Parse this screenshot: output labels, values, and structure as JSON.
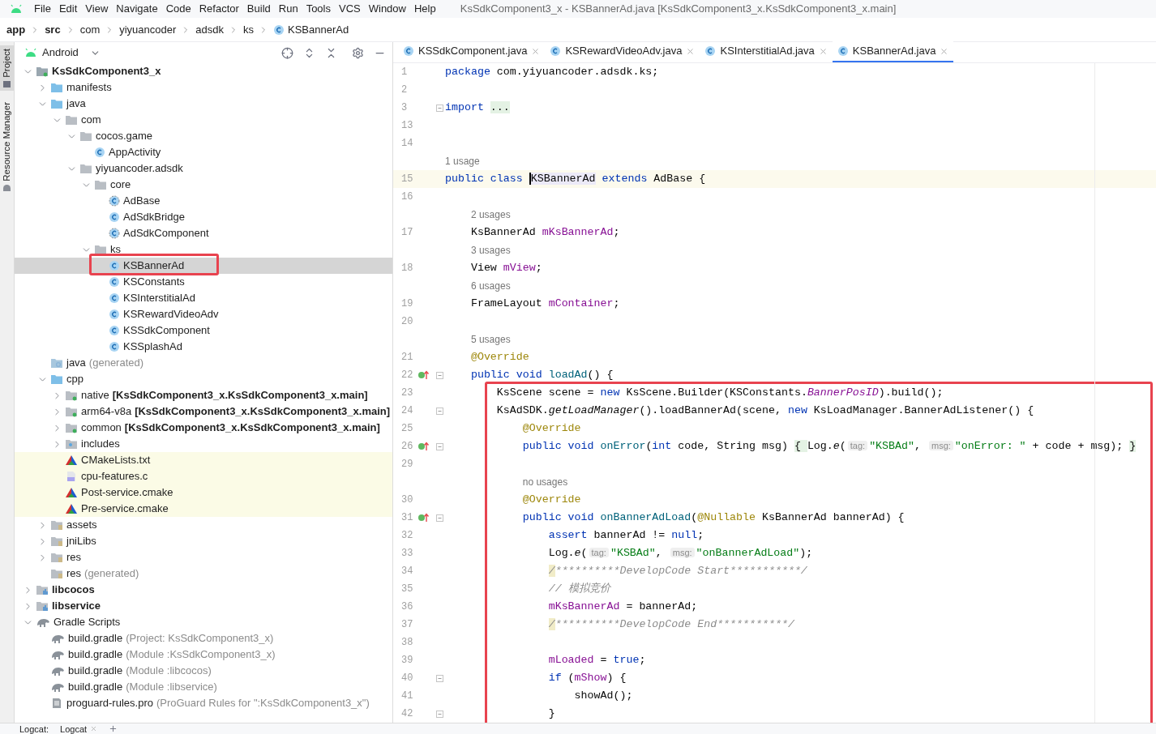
{
  "menu": [
    "File",
    "Edit",
    "View",
    "Navigate",
    "Code",
    "Refactor",
    "Build",
    "Run",
    "Tools",
    "VCS",
    "Window",
    "Help"
  ],
  "window": {
    "title": "KsSdkComponent3_x - KSBannerAd.java [KsSdkComponent3_x.KsSdkComponent3_x.main]"
  },
  "breadcrumb": [
    {
      "label": "app",
      "kind": "module"
    },
    {
      "label": "src",
      "kind": "module"
    },
    {
      "label": "com",
      "kind": "plain"
    },
    {
      "label": "yiyuancoder",
      "kind": "plain"
    },
    {
      "label": "adsdk",
      "kind": "plain"
    },
    {
      "label": "ks",
      "kind": "plain"
    },
    {
      "label": "KSBannerAd",
      "kind": "class"
    }
  ],
  "side_strip": [
    "Project",
    "Resource Manager"
  ],
  "project_panel": {
    "view": "Android",
    "tree": [
      {
        "label": "KsSdkComponent3_x",
        "kind": "project",
        "expanded": true,
        "selected": false,
        "children": [
          {
            "label": "manifests",
            "kind": "folder",
            "expanded": false,
            "selected": false
          },
          {
            "label": "java",
            "kind": "folder",
            "expanded": true,
            "selected": false,
            "children": [
              {
                "label": "com",
                "kind": "package",
                "expanded": true,
                "selected": false,
                "children": [
                  {
                    "label": "cocos.game",
                    "kind": "package",
                    "expanded": true,
                    "selected": false,
                    "children": [
                      {
                        "label": "AppActivity",
                        "kind": "class",
                        "selected": false
                      }
                    ]
                  },
                  {
                    "label": "yiyuancoder.adsdk",
                    "kind": "package",
                    "expanded": true,
                    "selected": false,
                    "children": [
                      {
                        "label": "core",
                        "kind": "package",
                        "expanded": true,
                        "selected": false,
                        "children": [
                          {
                            "label": "AdBase",
                            "kind": "abstract",
                            "selected": false
                          },
                          {
                            "label": "AdSdkBridge",
                            "kind": "class",
                            "selected": false
                          },
                          {
                            "label": "AdSdkComponent",
                            "kind": "abstract",
                            "selected": false
                          }
                        ]
                      },
                      {
                        "label": "ks",
                        "kind": "package",
                        "expanded": true,
                        "selected": false,
                        "children": [
                          {
                            "label": "KSBannerAd",
                            "kind": "class",
                            "selected": true,
                            "framed": true
                          },
                          {
                            "label": "KSConstants",
                            "kind": "class",
                            "selected": false
                          },
                          {
                            "label": "KSInterstitialAd",
                            "kind": "class",
                            "selected": false
                          },
                          {
                            "label": "KSRewardVideoAdv",
                            "kind": "class",
                            "selected": false
                          },
                          {
                            "label": "KSSdkComponent",
                            "kind": "class",
                            "selected": false
                          },
                          {
                            "label": "KSSplashAd",
                            "kind": "class",
                            "selected": false
                          }
                        ]
                      }
                    ]
                  }
                ]
              }
            ]
          },
          {
            "label": "java",
            "note": "(generated)",
            "kind": "generated",
            "selected": false
          },
          {
            "label": "cpp",
            "kind": "folder",
            "expanded": true,
            "selected": false,
            "children": [
              {
                "label": "native",
                "context": "[KsSdkComponent3_x.KsSdkComponent3_x.main]",
                "kind": "native",
                "expanded": false,
                "selected": false,
                "highlighted": false
              },
              {
                "label": "arm64-v8a",
                "context": "[KsSdkComponent3_x.KsSdkComponent3_x.main]",
                "kind": "native",
                "expanded": false,
                "selected": false,
                "highlighted": false
              },
              {
                "label": "common",
                "context": "[KsSdkComponent3_x.KsSdkComponent3_x.main]",
                "kind": "native",
                "expanded": false,
                "selected": false,
                "highlighted": false
              },
              {
                "label": "includes",
                "kind": "include",
                "expanded": false,
                "selected": false,
                "highlighted": false
              },
              {
                "label": "CMakeLists.txt",
                "kind": "cmake",
                "selected": false,
                "highlighted": true
              },
              {
                "label": "cpu-features.c",
                "kind": "cfile",
                "selected": false,
                "highlighted": true
              },
              {
                "label": "Post-service.cmake",
                "kind": "cmake",
                "selected": false,
                "highlighted": true
              },
              {
                "label": "Pre-service.cmake",
                "kind": "cmake",
                "selected": false,
                "highlighted": true
              }
            ]
          },
          {
            "label": "assets",
            "kind": "resfolder",
            "expanded": false,
            "selected": false
          },
          {
            "label": "jniLibs",
            "kind": "resfolder",
            "expanded": false,
            "selected": false
          },
          {
            "label": "res",
            "kind": "resfolder",
            "expanded": false,
            "selected": false
          },
          {
            "label": "res",
            "note": "(generated)",
            "kind": "resfolder",
            "selected": false
          }
        ]
      },
      {
        "label": "libcocos",
        "kind": "module",
        "expanded": false,
        "selected": false
      },
      {
        "label": "libservice",
        "kind": "module",
        "expanded": false,
        "selected": false
      },
      {
        "label": "Gradle Scripts",
        "kind": "gradle",
        "expanded": true,
        "selected": false,
        "children": [
          {
            "label": "build.gradle",
            "note": "(Project: KsSdkComponent3_x)",
            "kind": "gradle",
            "selected": false
          },
          {
            "label": "build.gradle",
            "note": "(Module :KsSdkComponent3_x)",
            "kind": "gradle",
            "selected": false
          },
          {
            "label": "build.gradle",
            "note": "(Module :libcocos)",
            "kind": "gradle",
            "selected": false
          },
          {
            "label": "build.gradle",
            "note": "(Module :libservice)",
            "kind": "gradle",
            "selected": false
          },
          {
            "label": "proguard-rules.pro",
            "note": "(ProGuard Rules for \":KsSdkComponent3_x\")",
            "kind": "text",
            "selected": false
          }
        ]
      }
    ]
  },
  "tabs": [
    {
      "label": "KSSdkComponent.java",
      "selected": false
    },
    {
      "label": "KSRewardVideoAdv.java",
      "selected": false
    },
    {
      "label": "KSInterstitialAd.java",
      "selected": false
    },
    {
      "label": "KSBannerAd.java",
      "selected": true
    }
  ],
  "editor": {
    "lines": [
      {
        "kind": "code",
        "number": "1",
        "tokens": [
          {
            "kind": "kw",
            "text": "package"
          },
          {
            "kind": "plain",
            "text": " com.yiyuancoder.adsdk.ks;"
          }
        ]
      },
      {
        "kind": "code",
        "number": "2"
      },
      {
        "kind": "code",
        "number": "3",
        "gutter": [
          {
            "kind": "fold"
          }
        ],
        "tokens": [
          {
            "kind": "kw",
            "text": "import "
          },
          {
            "kind": "fold",
            "text": "..."
          }
        ]
      },
      {
        "kind": "code",
        "number": "13"
      },
      {
        "kind": "code",
        "number": "14"
      },
      {
        "kind": "usage",
        "text": "1 usage"
      },
      {
        "kind": "code",
        "number": "15",
        "current": true,
        "tokens": [
          {
            "kind": "kw",
            "text": "public class "
          },
          {
            "kind": "ident",
            "text": "KSBannerAd"
          },
          {
            "kind": "kw",
            "text": " extends"
          },
          {
            "kind": "plain",
            "text": " AdBase {"
          }
        ]
      },
      {
        "kind": "code",
        "number": "16"
      },
      {
        "kind": "usage",
        "text": "2 usages"
      },
      {
        "kind": "code",
        "number": "17",
        "tokens": [
          {
            "kind": "plain",
            "text": "    KsBannerAd "
          },
          {
            "kind": "field",
            "text": "mKsBannerAd"
          },
          {
            "kind": "plain",
            "text": ";"
          }
        ]
      },
      {
        "kind": "usage",
        "text": "3 usages"
      },
      {
        "kind": "code",
        "number": "18",
        "tokens": [
          {
            "kind": "plain",
            "text": "    View "
          },
          {
            "kind": "field",
            "text": "mView"
          },
          {
            "kind": "plain",
            "text": ";"
          }
        ]
      },
      {
        "kind": "usage",
        "text": "6 usages"
      },
      {
        "kind": "code",
        "number": "19",
        "tokens": [
          {
            "kind": "plain",
            "text": "    FrameLayout "
          },
          {
            "kind": "field",
            "text": "mContainer"
          },
          {
            "kind": "plain",
            "text": ";"
          }
        ]
      },
      {
        "kind": "code",
        "number": "20"
      },
      {
        "kind": "usage",
        "text": "5 usages"
      },
      {
        "kind": "code",
        "number": "21",
        "tokens": [
          {
            "kind": "ann",
            "text": "    @Override"
          }
        ]
      },
      {
        "kind": "code",
        "number": "22",
        "gutter": [
          {
            "kind": "override"
          },
          {
            "kind": "fold"
          }
        ],
        "tokens": [
          {
            "kind": "kw",
            "text": "    public void "
          },
          {
            "kind": "method",
            "text": "loadAd"
          },
          {
            "kind": "plain",
            "text": "() {"
          }
        ]
      }
    ],
    "framed_lines": [
      {
        "kind": "code",
        "number": "23",
        "tokens": [
          {
            "kind": "plain",
            "text": "        KsScene scene = "
          },
          {
            "kind": "kw",
            "text": "new"
          },
          {
            "kind": "plain",
            "text": " KsScene.Builder(KSConstants."
          },
          {
            "kind": "sfield",
            "text": "BannerPosID"
          },
          {
            "kind": "plain",
            "text": ").build();"
          }
        ]
      },
      {
        "kind": "code",
        "number": "24",
        "gutter": [
          {
            "kind": "fold"
          }
        ],
        "tokens": [
          {
            "kind": "plain",
            "text": "        KsAdSDK."
          },
          {
            "kind": "it",
            "text": "getLoadManager"
          },
          {
            "kind": "plain",
            "text": "().loadBannerAd(scene, "
          },
          {
            "kind": "kw",
            "text": "new"
          },
          {
            "kind": "plain",
            "text": " KsLoadManager.BannerAdListener() {"
          }
        ]
      },
      {
        "kind": "code",
        "number": "25",
        "tokens": [
          {
            "kind": "ann",
            "text": "            @Override"
          }
        ]
      },
      {
        "kind": "code",
        "number": "26",
        "gutter": [
          {
            "kind": "override"
          },
          {
            "kind": "fold"
          }
        ],
        "tokens": [
          {
            "kind": "kw",
            "text": "            public void "
          },
          {
            "kind": "method",
            "text": "onError"
          },
          {
            "kind": "plain",
            "text": "("
          },
          {
            "kind": "kw",
            "text": "int"
          },
          {
            "kind": "plain",
            "text": " code, String msg) "
          },
          {
            "kind": "fold",
            "text": "{ "
          },
          {
            "kind": "plain",
            "text": "Log."
          },
          {
            "kind": "it",
            "text": "e"
          },
          {
            "kind": "plain",
            "text": "("
          },
          {
            "kind": "hint",
            "text": "tag:"
          },
          {
            "kind": "str",
            "text": "\"KSBAd\""
          },
          {
            "kind": "plain",
            "text": ", "
          },
          {
            "kind": "hint",
            "text": "msg:"
          },
          {
            "kind": "str",
            "text": "\"onError: \""
          },
          {
            "kind": "plain",
            "text": " + code + msg); "
          },
          {
            "kind": "fold",
            "text": "}"
          }
        ]
      },
      {
        "kind": "code",
        "number": "29"
      },
      {
        "kind": "usage",
        "text": "no usages"
      },
      {
        "kind": "code",
        "number": "30",
        "tokens": [
          {
            "kind": "ann",
            "text": "            @Override"
          }
        ]
      },
      {
        "kind": "code",
        "number": "31",
        "gutter": [
          {
            "kind": "override"
          },
          {
            "kind": "fold"
          }
        ],
        "tokens": [
          {
            "kind": "kw",
            "text": "            public void "
          },
          {
            "kind": "method",
            "text": "onBannerAdLoad"
          },
          {
            "kind": "plain",
            "text": "("
          },
          {
            "kind": "ann",
            "text": "@Nullable"
          },
          {
            "kind": "plain",
            "text": " KsBannerAd bannerAd) {"
          }
        ]
      },
      {
        "kind": "code",
        "number": "32",
        "tokens": [
          {
            "kind": "kw",
            "text": "                assert"
          },
          {
            "kind": "plain",
            "text": " bannerAd != "
          },
          {
            "kind": "kw",
            "text": "null"
          },
          {
            "kind": "plain",
            "text": ";"
          }
        ]
      },
      {
        "kind": "code",
        "number": "33",
        "tokens": [
          {
            "kind": "plain",
            "text": "                Log."
          },
          {
            "kind": "it",
            "text": "e"
          },
          {
            "kind": "plain",
            "text": "("
          },
          {
            "kind": "hint",
            "text": "tag:"
          },
          {
            "kind": "str",
            "text": "\"KSBAd\""
          },
          {
            "kind": "plain",
            "text": ", "
          },
          {
            "kind": "hint",
            "text": "msg:"
          },
          {
            "kind": "str",
            "text": "\"onBannerAdLoad\""
          },
          {
            "kind": "plain",
            "text": ");"
          }
        ]
      },
      {
        "kind": "code",
        "number": "34",
        "tokens": [
          {
            "kind": "todo",
            "text": "                /"
          },
          {
            "kind": "cmt",
            "text": "**********DevelopCode Start***********/"
          }
        ]
      },
      {
        "kind": "code",
        "number": "35",
        "tokens": [
          {
            "kind": "cmt",
            "text": "                // 模拟竞价"
          }
        ]
      },
      {
        "kind": "code",
        "number": "36",
        "tokens": [
          {
            "kind": "field",
            "text": "                mKsBannerAd"
          },
          {
            "kind": "plain",
            "text": " = bannerAd;"
          }
        ]
      },
      {
        "kind": "code",
        "number": "37",
        "tokens": [
          {
            "kind": "todo",
            "text": "                /"
          },
          {
            "kind": "cmt",
            "text": "**********DevelopCode End***********/"
          }
        ]
      },
      {
        "kind": "code",
        "number": "38"
      },
      {
        "kind": "code",
        "number": "39",
        "tokens": [
          {
            "kind": "field",
            "text": "                mLoaded"
          },
          {
            "kind": "plain",
            "text": " = "
          },
          {
            "kind": "kw",
            "text": "true"
          },
          {
            "kind": "plain",
            "text": ";"
          }
        ]
      },
      {
        "kind": "code",
        "number": "40",
        "gutter": [
          {
            "kind": "fold"
          }
        ],
        "tokens": [
          {
            "kind": "kw",
            "text": "                if"
          },
          {
            "kind": "plain",
            "text": " ("
          },
          {
            "kind": "field",
            "text": "mShow"
          },
          {
            "kind": "plain",
            "text": ") {"
          }
        ]
      },
      {
        "kind": "code",
        "number": "41",
        "tokens": [
          {
            "kind": "plain",
            "text": "                    showAd();"
          }
        ]
      },
      {
        "kind": "code",
        "number": "42",
        "gutter": [
          {
            "kind": "fold"
          }
        ],
        "tokens": [
          {
            "kind": "plain",
            "text": "                }"
          }
        ]
      }
    ]
  },
  "bottom_bar": {
    "label": "Logcat:",
    "tabs": [
      {
        "label": "Logcat",
        "selected": true
      }
    ]
  }
}
